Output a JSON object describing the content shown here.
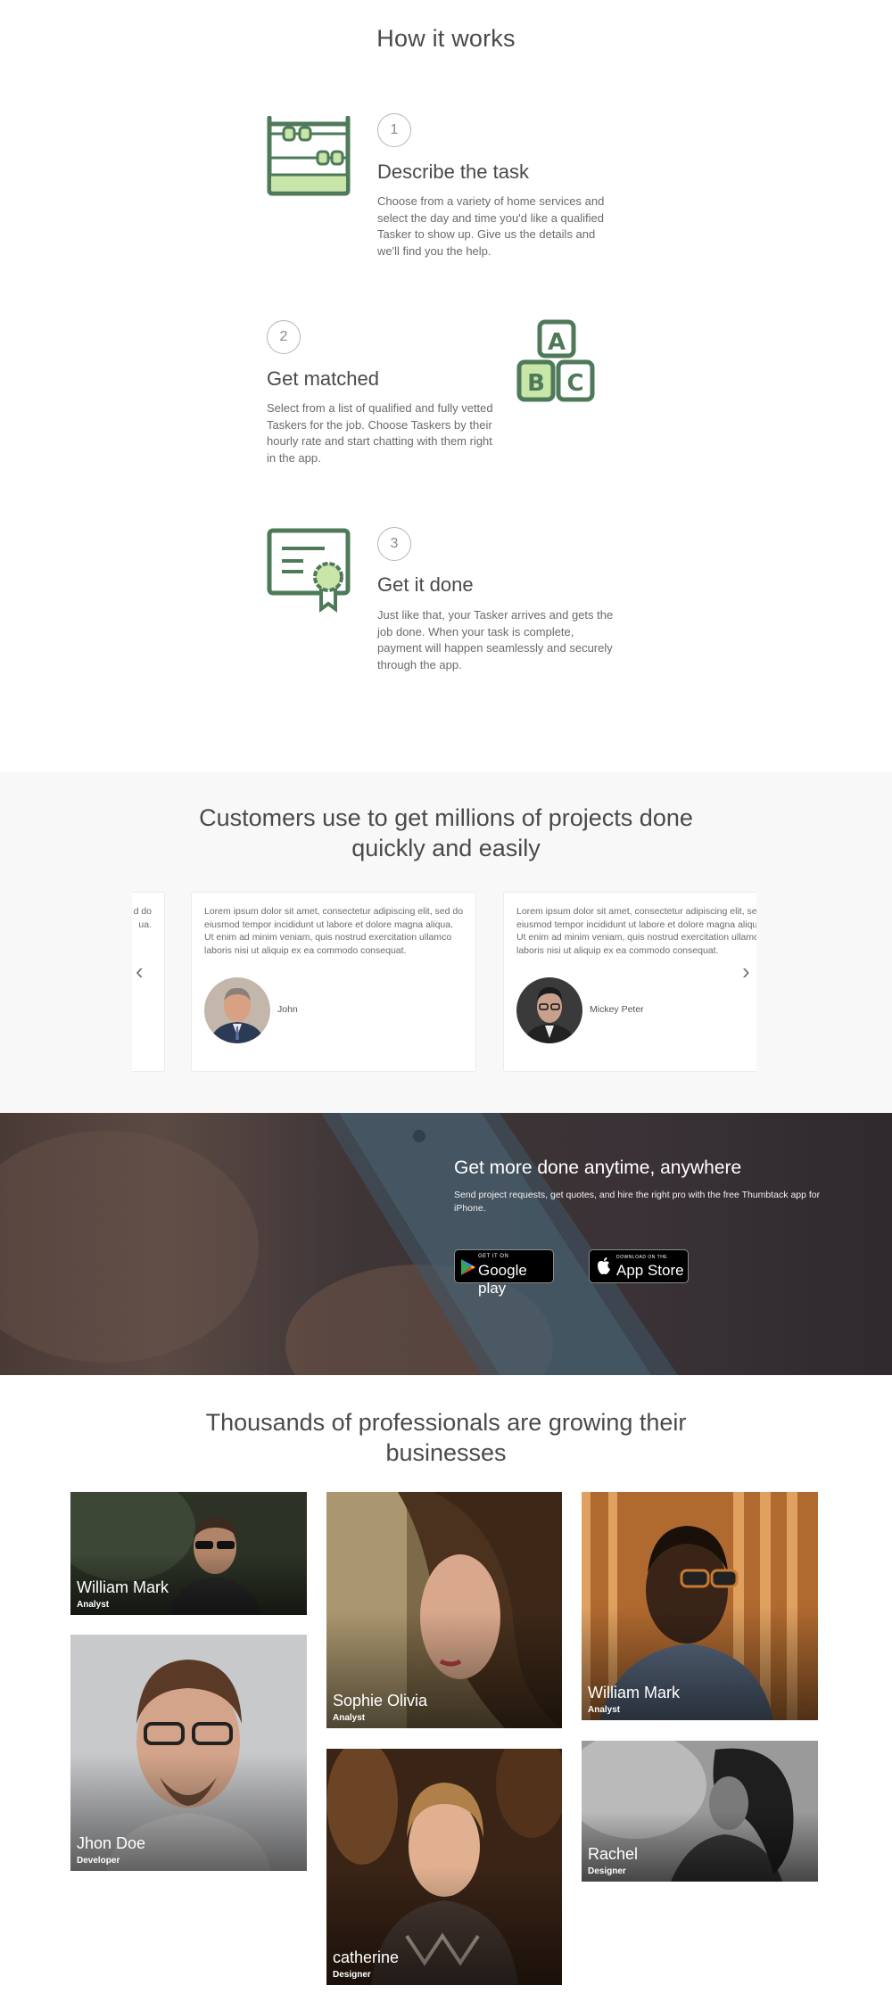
{
  "how_it_works": {
    "title": "How it works",
    "steps": [
      {
        "number": "1",
        "title": "Describe the task",
        "icon": "abacus-icon",
        "description": [
          "Choose from a variety of home services and",
          "select the day and time you'd like a qualified",
          "Tasker to show up. Give us the details and",
          "we'll find you the help."
        ]
      },
      {
        "number": "2",
        "title": "Get matched",
        "icon": "abc-blocks-icon",
        "description": [
          "Select from a list of qualified and fully vetted",
          "Taskers for the job. Choose Taskers by their",
          "hourly rate and start chatting with them right",
          "in the app."
        ]
      },
      {
        "number": "3",
        "title": "Get it done",
        "icon": "certificate-icon",
        "description": [
          "Just like that, your Tasker arrives and gets the",
          "job done. When your task is complete,",
          "payment will happen seamlessly and securely",
          "through the app."
        ]
      }
    ]
  },
  "testimonials": {
    "title_line1": "Customers use to get millions of projects done",
    "title_line2": "quickly and easily",
    "prev_arrow": "‹",
    "next_arrow": "›",
    "partial_left_lines": [
      "d do",
      "ua."
    ],
    "cards": [
      {
        "name": "John",
        "lines": [
          "Lorem ipsum dolor sit amet, consectetur adipiscing elit, sed do",
          "eiusmod tempor incididunt ut labore et dolore magna aliqua.",
          "Ut enim ad minim veniam, quis nostrud exercitation ullamco",
          "laboris nisi ut aliquip ex ea commodo consequat."
        ]
      },
      {
        "name": "Mickey Peter",
        "lines": [
          "Lorem ipsum dolor sit amet, consectetur adipiscing elit, sed do",
          "eiusmod tempor incididunt ut labore et dolore magna aliqua.",
          "Ut enim ad minim veniam, quis nostrud exercitation ullamco",
          "laboris nisi ut aliquip ex ea commodo consequat."
        ]
      }
    ]
  },
  "app_banner": {
    "title": "Get more done anytime, anywhere",
    "subtitle_line1": "Send project requests, get quotes, and hire the right pro with the free Thumbtack app for",
    "subtitle_line2": "iPhone.",
    "google_play": {
      "small": "GET IT ON",
      "big": "Google play"
    },
    "app_store": {
      "small": "DOWNLOAD ON THE",
      "big": "App Store"
    }
  },
  "professionals": {
    "title_line1": "Thousands of professionals are growing their",
    "title_line2": "businesses",
    "people": [
      {
        "name": "William Mark",
        "role": "Analyst"
      },
      {
        "name": "Jhon Doe",
        "role": "Developer"
      },
      {
        "name": "Sophie Olivia",
        "role": "Analyst"
      },
      {
        "name": "catherine",
        "role": "Designer"
      },
      {
        "name": "William Mark",
        "role": "Analyst"
      },
      {
        "name": "Rachel",
        "role": "Designer"
      }
    ]
  },
  "colors": {
    "icon_green": "#4e7a59",
    "icon_light_green": "#c9e5a8",
    "band_grey": "#f8f8f8"
  }
}
